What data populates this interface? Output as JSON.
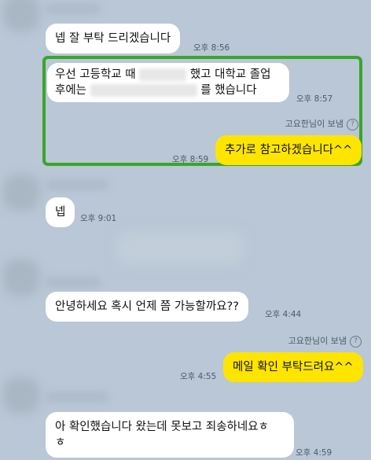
{
  "messages": [
    {
      "text": "넵 잘 부탁 드리겠습니다",
      "time": "오후 8:56"
    },
    {
      "line1_a": "우선 고등학교 때",
      "line1_b": "했고 대학교 졸업",
      "line2_a": "후에는",
      "line2_b": "를 했습니다",
      "time": "오후 8:57"
    },
    {
      "text": "추가로 참고하겠습니다^^",
      "time": "오후 8:59"
    },
    {
      "text": "넵",
      "time": "오후 9:01"
    },
    {
      "text": "안녕하세요 혹시 언제 쯤 가능할까요??",
      "time": "오후 4:44"
    },
    {
      "text": "메일 확인 부탁드려요^^",
      "time": "오후 4:55"
    },
    {
      "line1": "아 확인했습니다 왔는데 못보고 죄송하네요ㅎ",
      "line2": "ㅎ",
      "time": "오후 4:59"
    }
  ],
  "sender_note": "고요한님이 보냄",
  "sender_note_icon": "?",
  "colors": {
    "background": "#b9c7d6",
    "outgoing": "#fee500",
    "incoming": "#ffffff",
    "highlight": "#3aa52a"
  }
}
